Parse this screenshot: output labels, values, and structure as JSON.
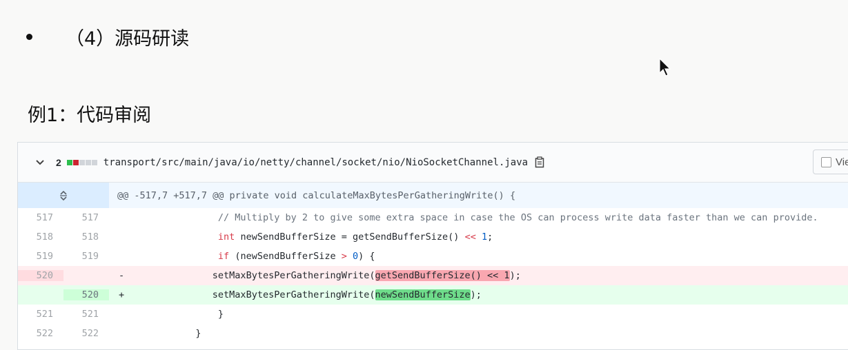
{
  "slide": {
    "bullet_text": "（4）源码研读",
    "example_title": "例1：代码审阅"
  },
  "diff": {
    "changes_count": "2",
    "blocks": [
      "#2cbe4e",
      "#cb2431",
      "#d1d5da",
      "#d1d5da",
      "#d1d5da"
    ],
    "file_path": "transport/src/main/java/io/netty/channel/socket/nio/NioSocketChannel.java",
    "view_label": "Vie",
    "hunk_header": "@@ -517,7 +517,7 @@ private void calculateMaxBytesPerGatheringWrite() {",
    "lines": [
      {
        "type": "ctx",
        "old": "517",
        "new": "517",
        "marker": "",
        "indent": "               ",
        "segments": [
          {
            "t": "// Multiply by 2 to give some extra space in case the OS can process write data faster than we can provide.",
            "c": "cm"
          }
        ]
      },
      {
        "type": "ctx",
        "old": "518",
        "new": "518",
        "marker": "",
        "indent": "               ",
        "segments": [
          {
            "t": "int",
            "c": "kw"
          },
          {
            "t": " newSendBufferSize = getSendBufferSize() ",
            "c": ""
          },
          {
            "t": "<<",
            "c": "kw"
          },
          {
            "t": " ",
            "c": ""
          },
          {
            "t": "1",
            "c": "num"
          },
          {
            "t": ";",
            "c": ""
          }
        ]
      },
      {
        "type": "ctx",
        "old": "519",
        "new": "519",
        "marker": "",
        "indent": "               ",
        "segments": [
          {
            "t": "if",
            "c": "kw"
          },
          {
            "t": " (newSendBufferSize ",
            "c": ""
          },
          {
            "t": ">",
            "c": "kw"
          },
          {
            "t": " ",
            "c": ""
          },
          {
            "t": "0",
            "c": "num"
          },
          {
            "t": ") {",
            "c": ""
          }
        ]
      },
      {
        "type": "del",
        "old": "520",
        "new": "",
        "marker": "-",
        "indent": "              ",
        "segments": [
          {
            "t": "setMaxBytesPerGatheringWrite(",
            "c": ""
          },
          {
            "t": "getSendBufferSize() << 1",
            "c": "hl-del"
          },
          {
            "t": ");",
            "c": ""
          }
        ]
      },
      {
        "type": "add",
        "old": "",
        "new": "520",
        "marker": "+",
        "indent": "              ",
        "segments": [
          {
            "t": "setMaxBytesPerGatheringWrite(",
            "c": ""
          },
          {
            "t": "newSendBufferSize",
            "c": "hl-add"
          },
          {
            "t": ");",
            "c": ""
          }
        ]
      },
      {
        "type": "ctx",
        "old": "521",
        "new": "521",
        "marker": "",
        "indent": "               ",
        "segments": [
          {
            "t": "}",
            "c": ""
          }
        ]
      },
      {
        "type": "ctx",
        "old": "522",
        "new": "522",
        "marker": "",
        "indent": "           ",
        "segments": [
          {
            "t": "}",
            "c": ""
          }
        ]
      }
    ]
  }
}
